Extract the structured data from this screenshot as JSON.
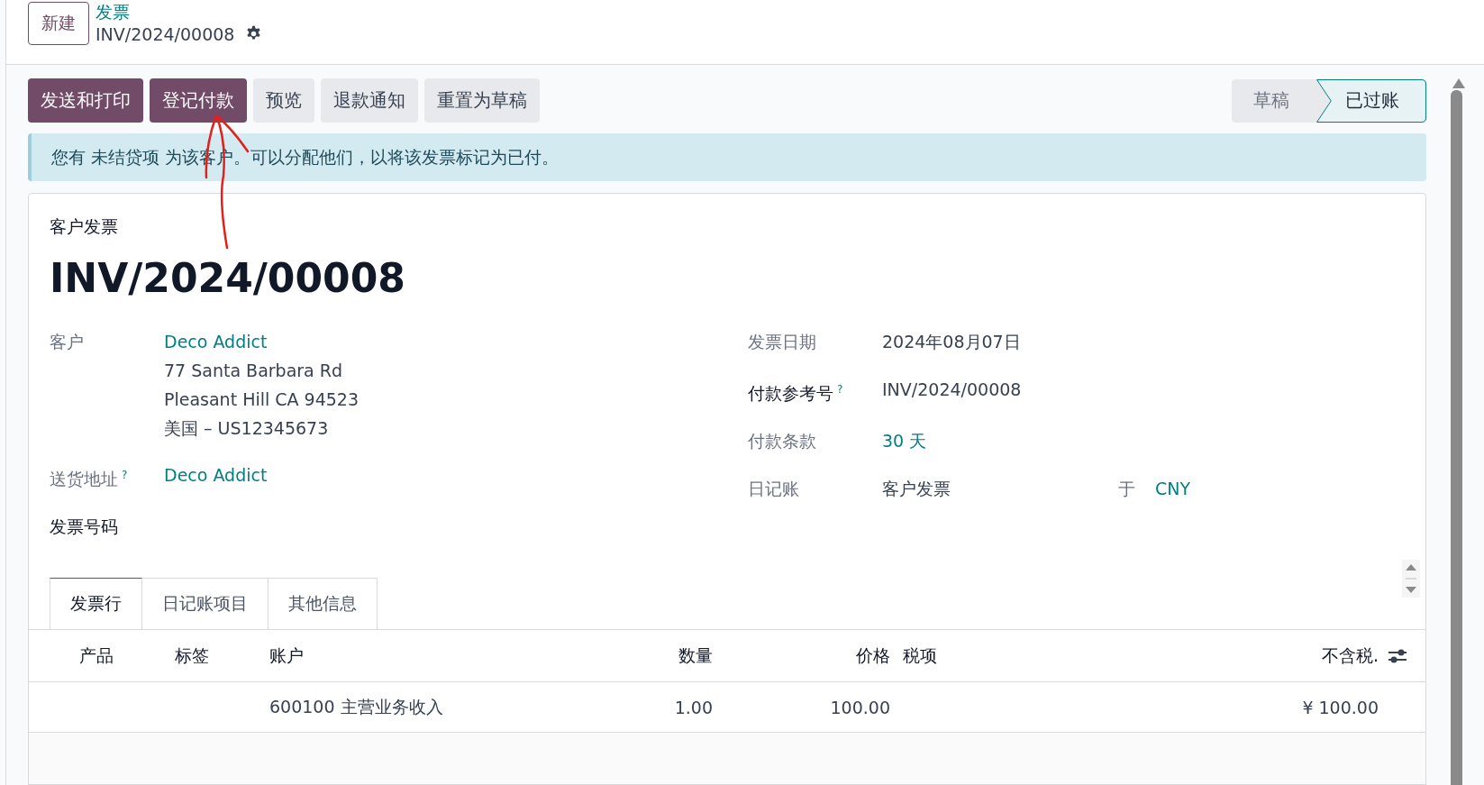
{
  "breadcrumb": {
    "new_button": "新建",
    "parent": "发票",
    "current": "INV/2024/00008"
  },
  "action_buttons": [
    {
      "label": "发送和打印",
      "kind": "primary"
    },
    {
      "label": "登记付款",
      "kind": "primary"
    },
    {
      "label": "预览",
      "kind": "secondary"
    },
    {
      "label": "退款通知",
      "kind": "secondary"
    },
    {
      "label": "重置为草稿",
      "kind": "secondary"
    }
  ],
  "status_bar": [
    {
      "label": "草稿",
      "selected": false
    },
    {
      "label": "已过账",
      "selected": true
    }
  ],
  "alert": {
    "text": "您有 未结贷项 为该客户。可以分配他们，以将该发票标记为已付。"
  },
  "form": {
    "type_label": "客户发票",
    "name": "INV/2024/00008",
    "left_fields": [
      {
        "label": "客户",
        "kind": "address",
        "link": "Deco Addict",
        "lines": [
          "77 Santa Barbara Rd",
          "Pleasant Hill CA 94523",
          "美国 – US12345673"
        ]
      },
      {
        "label": "送货地址",
        "help": "?",
        "kind": "link",
        "value": "Deco Addict"
      },
      {
        "label": "发票号码",
        "emphasized": true,
        "kind": "heading"
      }
    ],
    "right_fields": [
      {
        "label": "发票日期",
        "kind": "text",
        "value": "2024年08月07日"
      },
      {
        "label": "付款参考号",
        "help": "?",
        "emphasized": true,
        "kind": "text",
        "value": "INV/2024/00008"
      },
      {
        "label": "付款条款",
        "kind": "link",
        "value": "30 天"
      },
      {
        "label": "日记账",
        "kind": "journal",
        "value": "客户发票",
        "connector": "于",
        "currency": "CNY"
      }
    ]
  },
  "tabs": [
    {
      "label": "发票行",
      "selected": true
    },
    {
      "label": "日记账项目",
      "selected": false
    },
    {
      "label": "其他信息",
      "selected": false
    }
  ],
  "table": {
    "columns": [
      "产品",
      "标签",
      "账户",
      "数量",
      "价格",
      "税项",
      "不含税."
    ],
    "rows": [
      {
        "account": "600100 主营业务收入",
        "quantity": "1.00",
        "price": "100.00",
        "subtotal": "¥ 100.00"
      }
    ]
  }
}
